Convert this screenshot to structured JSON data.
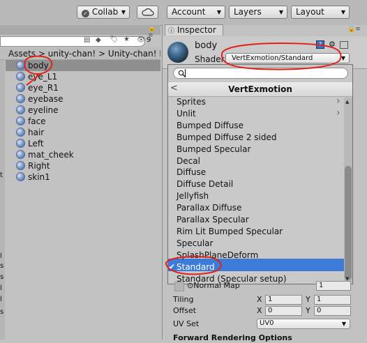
{
  "toolbar": {
    "collab_label": "Collab",
    "account_label": "Account",
    "layers_label": "Layers",
    "layout_label": "Layout"
  },
  "project": {
    "breadcrumb": [
      "Assets",
      "unity-chan!",
      "Unity-chan! Mo"
    ],
    "selected_index": 0,
    "assets": [
      "body",
      "eye_L1",
      "eye_R1",
      "eyebase",
      "eyeline",
      "face",
      "hair",
      "Left",
      "mat_cheek",
      "Right",
      "skin1"
    ],
    "icon_count": "9",
    "left_cut_letters": [
      "t",
      "l",
      "s",
      "s",
      "l",
      "l",
      "s"
    ]
  },
  "inspector": {
    "tab_label": "Inspector",
    "material_name": "body",
    "shader_label": "Shader",
    "shader_value": "VertExmotion/Standard",
    "popup_title": "VertExmotion",
    "popup_back": "<",
    "shader_items": [
      {
        "label": "Sprites",
        "submenu": true,
        "checked": false
      },
      {
        "label": "Unlit",
        "submenu": true,
        "checked": false
      },
      {
        "label": "Bumped Diffuse",
        "submenu": false,
        "checked": false
      },
      {
        "label": "Bumped Diffuse 2 sided",
        "submenu": false,
        "checked": false
      },
      {
        "label": "Bumped Specular",
        "submenu": false,
        "checked": false
      },
      {
        "label": "Decal",
        "submenu": false,
        "checked": false
      },
      {
        "label": "Diffuse",
        "submenu": false,
        "checked": false
      },
      {
        "label": "Diffuse Detail",
        "submenu": false,
        "checked": false
      },
      {
        "label": "Jellyfish",
        "submenu": false,
        "checked": false
      },
      {
        "label": "Parallax Diffuse",
        "submenu": false,
        "checked": false
      },
      {
        "label": "Parallax Specular",
        "submenu": false,
        "checked": false
      },
      {
        "label": "Rim Lit Bumped Specular",
        "submenu": false,
        "checked": false
      },
      {
        "label": "Specular",
        "submenu": false,
        "checked": false
      },
      {
        "label": "SplashPlaneDeform",
        "submenu": false,
        "checked": false
      },
      {
        "label": "Standard",
        "submenu": false,
        "checked": true
      },
      {
        "label": "Standard (Specular setup)",
        "submenu": false,
        "checked": false
      }
    ],
    "normal_map_label": "⊙Normal Map",
    "normal_map_value": "1",
    "tiling_label": "Tiling",
    "tiling_x": "1",
    "tiling_y": "1",
    "offset_label": "Offset",
    "offset_x": "0",
    "offset_y": "0",
    "uvset_label": "UV Set",
    "uvset_value": "UV0",
    "x_label": "X",
    "y_label": "Y",
    "forward_rendering_label": "Forward Rendering Options"
  },
  "colors": {
    "selection_blue": "#3d7bd9",
    "annotation_red": "#e0221a"
  }
}
